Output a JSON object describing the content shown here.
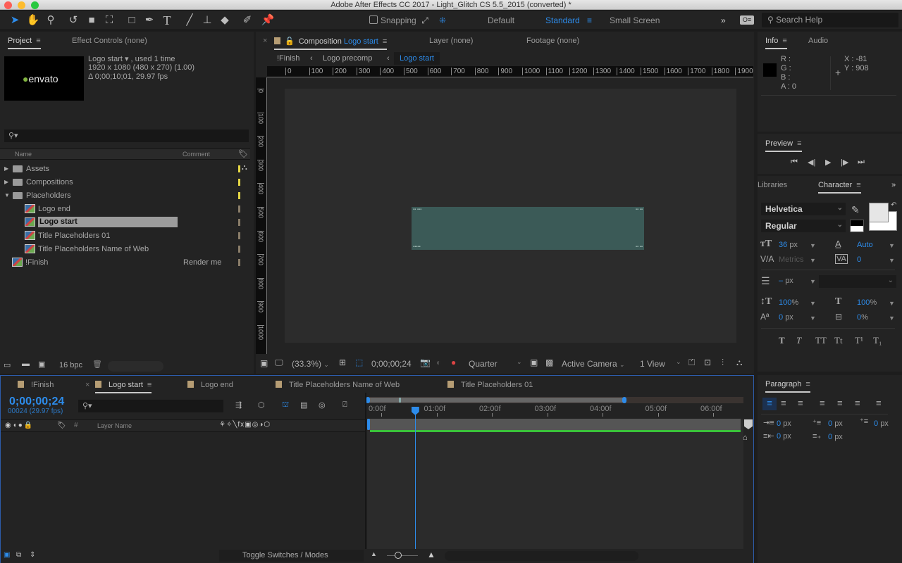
{
  "window": {
    "title": "Adobe After Effects CC 2017 - Light_Glitch CS 5.5_2015 (converted) *"
  },
  "toolbar": {
    "tools": [
      "selection-tool",
      "hand-tool",
      "zoom-tool",
      "rotate-tool",
      "camera-tool",
      "pan-behind-tool",
      "rectangle-tool",
      "pen-tool",
      "type-tool",
      "brush-tool",
      "clone-stamp-tool",
      "eraser-tool",
      "roto-brush-tool",
      "puppet-tool"
    ],
    "snapping_label": "Snapping",
    "snapping_checked": false,
    "workspaces": [
      "Default",
      "Standard",
      "Small Screen"
    ],
    "active_workspace": "Standard",
    "search_help_placeholder": "Search Help"
  },
  "project": {
    "tabs": [
      "Project",
      "Effect Controls (none)"
    ],
    "thumbnail_text": "envato",
    "selected_info": {
      "name": "Logo start ▾ , used 1 time",
      "size": "1920 x 1080  (480 x 270) (1.00)",
      "duration": "Δ 0;00;10;01, 29.97 fps"
    },
    "search_placeholder": "",
    "columns": {
      "name": "Name",
      "comment": "Comment"
    },
    "items": [
      {
        "name": "Assets",
        "type": "folder",
        "expanded": false,
        "comment": "",
        "label": "yellow",
        "indent": 0
      },
      {
        "name": "Compositions",
        "type": "folder",
        "expanded": false,
        "comment": "",
        "label": "yellow",
        "indent": 0
      },
      {
        "name": "Placeholders",
        "type": "folder",
        "expanded": true,
        "comment": "",
        "label": "yellow",
        "indent": 0
      },
      {
        "name": "Logo end",
        "type": "comp",
        "comment": "",
        "label": "tan",
        "indent": 1
      },
      {
        "name": "Logo start",
        "type": "comp",
        "comment": "",
        "label": "tan",
        "indent": 1,
        "selected": true
      },
      {
        "name": "Title Placeholders 01",
        "type": "comp",
        "comment": "",
        "label": "tan",
        "indent": 1
      },
      {
        "name": "Title Placeholders Name of Web",
        "type": "comp",
        "comment": "",
        "label": "tan",
        "indent": 1
      },
      {
        "name": "!Finish",
        "type": "comp",
        "comment": "Render me",
        "label": "tan",
        "indent": 0
      }
    ],
    "bpc": "16 bpc"
  },
  "composition": {
    "tab_prefix": "Composition",
    "tab_name": "Logo start",
    "other_tabs": [
      "Layer (none)",
      "Footage (none)"
    ],
    "breadcrumbs": [
      "!Finish",
      "Logo precomp",
      "Logo start"
    ],
    "ruler_top": [
      "0",
      "100",
      "200",
      "300",
      "400",
      "500",
      "600",
      "700",
      "800",
      "900",
      "1000",
      "1100",
      "1200",
      "1300",
      "1400",
      "1500",
      "1600",
      "1700",
      "1800",
      "1900"
    ],
    "ruler_left": [
      "0",
      "100",
      "200",
      "300",
      "400",
      "500",
      "600",
      "700",
      "800",
      "900",
      "1000"
    ],
    "footer": {
      "zoom": "(33.3%)",
      "timecode": "0;00;00;24",
      "resolution": "Quarter",
      "camera": "Active Camera",
      "views": "1 View"
    }
  },
  "info": {
    "tabs": [
      "Info",
      "Audio"
    ],
    "r": "R :",
    "g": "G :",
    "b": "B :",
    "a": "A : 0",
    "x": "X : -81",
    "y": "Y : 908"
  },
  "preview": {
    "title": "Preview"
  },
  "character": {
    "tabs": [
      "Libraries",
      "Character"
    ],
    "font": "Helvetica",
    "style": "Regular",
    "size": "36",
    "size_unit": "px",
    "leading": "Auto",
    "kerning": "Metrics",
    "tracking": "0",
    "stroke_width": "–",
    "stroke_unit": "px",
    "vscale": "100",
    "hscale": "100",
    "pct": "%",
    "baseline": "0",
    "baseline_unit": "px",
    "tsume": "0",
    "tsume_unit": "%",
    "styles": [
      "T",
      "T",
      "TT",
      "Tt",
      "T¹",
      "T₁"
    ]
  },
  "paragraph": {
    "title": "Paragraph",
    "indent_left": "0",
    "indent_first": "0",
    "space_before": "0",
    "indent_right": "0",
    "space_after": "0",
    "unit": "px"
  },
  "timeline": {
    "tabs": [
      "!Finish",
      "Logo start",
      "Logo end",
      "Title Placeholders Name of Web",
      "Title Placeholders 01"
    ],
    "active_tab": "Logo start",
    "timecode": "0;00;00;24",
    "frame_info": "00024 (29.97 fps)",
    "search_placeholder": "",
    "layer_name_header": "Layer Name",
    "hash_header": "#",
    "time_ticks": [
      "0:00f",
      "01:00f",
      "02:00f",
      "03:00f",
      "04:00f",
      "05:00f",
      "06:00f"
    ],
    "toggle_label": "Toggle Switches / Modes",
    "playhead_seconds": 0.8,
    "work_area_end_seconds": 4.4
  }
}
